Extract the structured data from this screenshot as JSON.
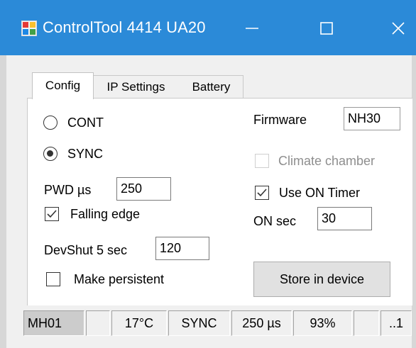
{
  "window": {
    "title": "ControlTool 4414 UA20",
    "controls": {
      "minimize": "—",
      "maximize": "☐",
      "close": "✕"
    }
  },
  "tabs": [
    {
      "label": "Config",
      "selected": true
    },
    {
      "label": "IP Settings",
      "selected": false
    },
    {
      "label": "Battery",
      "selected": false
    }
  ],
  "config": {
    "mode_cont_label": "CONT",
    "mode_sync_label": "SYNC",
    "selected_mode": "SYNC",
    "pwd_label": "PWD µs",
    "pwd_value": "250",
    "falling_edge_label": "Falling edge",
    "falling_edge_checked": true,
    "devshut_label": "DevShut 5 sec",
    "devshut_value": "120",
    "make_persistent_label": "Make persistent",
    "make_persistent_checked": false,
    "firmware_label": "Firmware",
    "firmware_value": "NH30",
    "climate_chamber_label": "Climate chamber",
    "climate_chamber_enabled": false,
    "use_on_timer_label": "Use ON Timer",
    "use_on_timer_checked": true,
    "on_sec_label": "ON sec",
    "on_sec_value": "30",
    "store_button_label": "Store in device"
  },
  "statusbar": [
    {
      "text": "MH01",
      "highlight": true
    },
    {
      "text": ""
    },
    {
      "text": "17°C"
    },
    {
      "text": "SYNC"
    },
    {
      "text": "250 µs"
    },
    {
      "text": "93%"
    },
    {
      "text": ""
    },
    {
      "text": "..1"
    }
  ],
  "colors": {
    "titlebar": "#2b8ad8",
    "window_bg": "#f0f0f0",
    "panel_bg": "#ffffff",
    "status_highlight": "#cccccc",
    "disabled_text": "#8e8e8e"
  }
}
